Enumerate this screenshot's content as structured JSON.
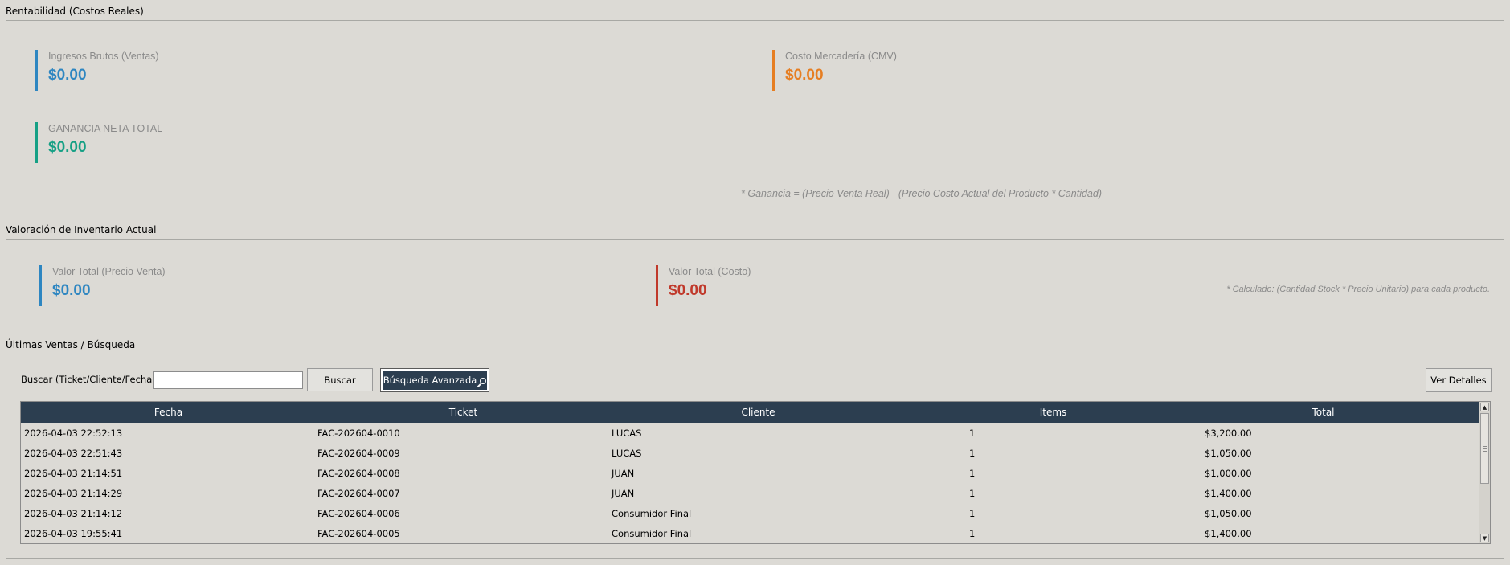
{
  "rentabilidad": {
    "title": "Rentabilidad (Costos Reales)",
    "ingresos_label": "Ingresos Brutos (Ventas)",
    "ingresos_value": "$0.00",
    "costo_label": "Costo Mercadería (CMV)",
    "costo_value": "$0.00",
    "ganancia_label": "GANANCIA NETA TOTAL",
    "ganancia_value": "$0.00",
    "note": "* Ganancia = (Precio Venta Real) - (Precio Costo Actual del Producto * Cantidad)"
  },
  "inventario": {
    "title": "Valoración de Inventario Actual",
    "venta_label": "Valor Total (Precio Venta)",
    "venta_value": "$0.00",
    "costo_label": "Valor Total (Costo)",
    "costo_value": "$0.00",
    "note": "* Calculado: (Cantidad Stock * Precio Unitario) para cada producto."
  },
  "ventas": {
    "title": "Últimas Ventas / Búsqueda",
    "search_label": "Buscar (Ticket/Cliente/Fecha):",
    "search_value": "",
    "search_button": "Buscar",
    "advanced_button": "Búsqueda Avanzada",
    "details_button": "Ver Detalles",
    "columns": [
      "Fecha",
      "Ticket",
      "Cliente",
      "Items",
      "Total"
    ],
    "rows": [
      [
        "2026-04-03 22:52:13",
        "FAC-202604-0010",
        "LUCAS",
        "1",
        "$3,200.00"
      ],
      [
        "2026-04-03 22:51:43",
        "FAC-202604-0009",
        "LUCAS",
        "1",
        "$1,050.00"
      ],
      [
        "2026-04-03 21:14:51",
        "FAC-202604-0008",
        "JUAN",
        "1",
        "$1,000.00"
      ],
      [
        "2026-04-03 21:14:29",
        "FAC-202604-0007",
        "JUAN",
        "1",
        "$1,400.00"
      ],
      [
        "2026-04-03 21:14:12",
        "FAC-202604-0006",
        "Consumidor Final",
        "1",
        "$1,050.00"
      ],
      [
        "2026-04-03 19:55:41",
        "FAC-202604-0005",
        "Consumidor Final",
        "1",
        "$1,400.00"
      ]
    ]
  },
  "icons": {
    "advanced_search": "magnifier-icon",
    "scroll_up": "scroll-up-arrow-icon",
    "scroll_down": "scroll-down-arrow-icon"
  },
  "colors": {
    "blue": "#2e86c1",
    "orange": "#e67e22",
    "green": "#16a085",
    "red": "#c0392b",
    "header": "#2c3e50"
  }
}
